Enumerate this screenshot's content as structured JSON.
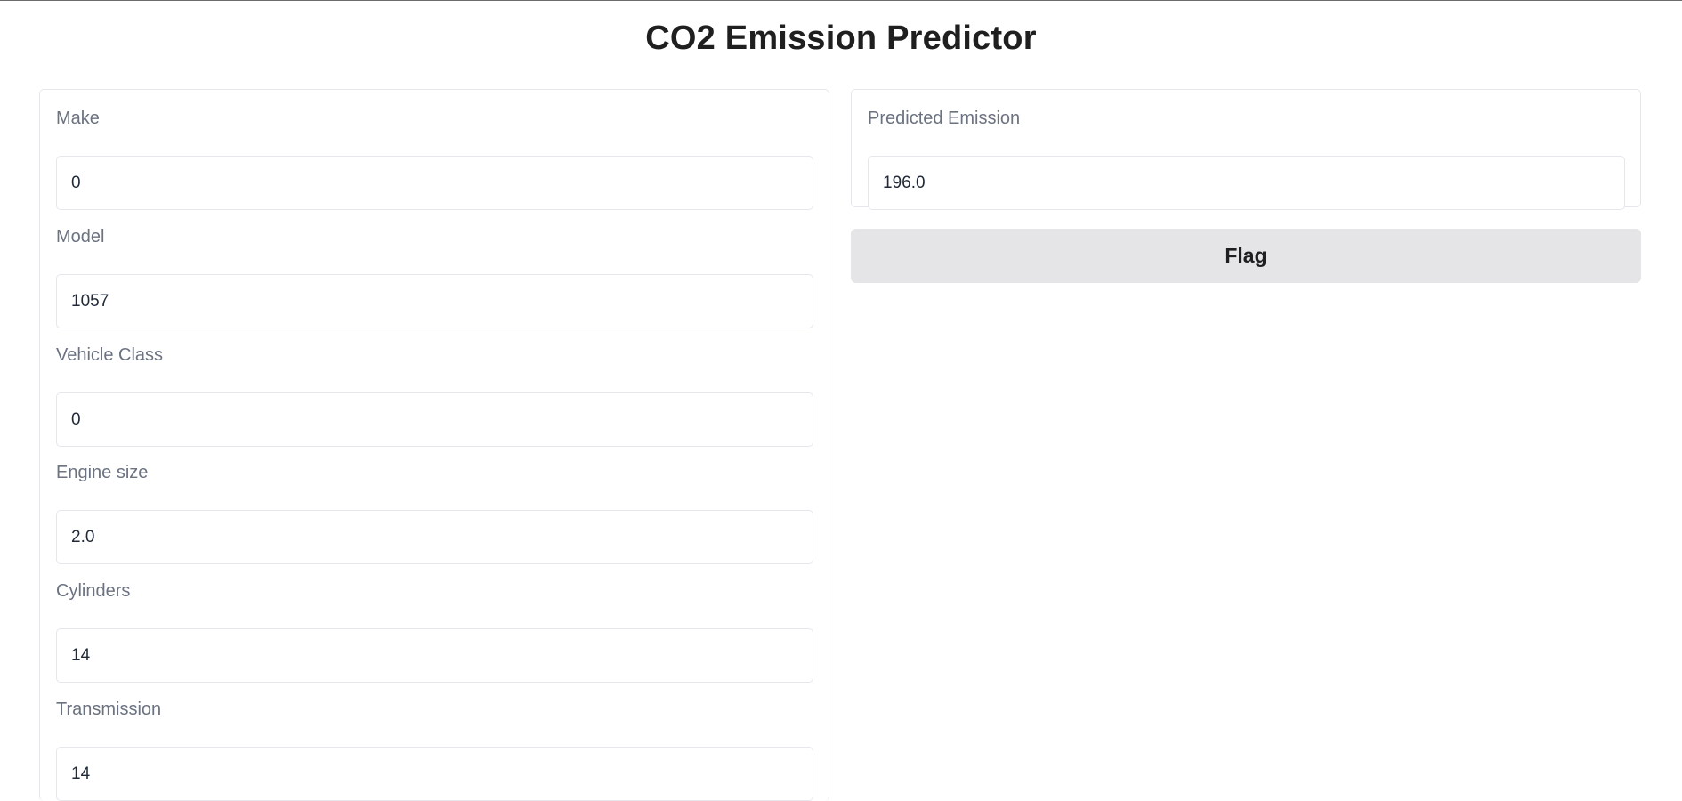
{
  "page": {
    "title": "CO2 Emission Predictor"
  },
  "inputs": {
    "make": {
      "label": "Make",
      "value": "0"
    },
    "model": {
      "label": "Model",
      "value": "1057"
    },
    "vehicle_class": {
      "label": "Vehicle Class",
      "value": "0"
    },
    "engine_size": {
      "label": "Engine size",
      "value": "2.0"
    },
    "cylinders": {
      "label": "Cylinders",
      "value": "14"
    },
    "transmission": {
      "label": "Transmission",
      "value": "14"
    }
  },
  "output": {
    "label": "Predicted Emission",
    "value": "196.0"
  },
  "actions": {
    "flag_label": "Flag"
  },
  "colors": {
    "label_text": "#6b7280",
    "border": "#e5e7eb",
    "flag_button_bg": "#e5e5e7"
  }
}
